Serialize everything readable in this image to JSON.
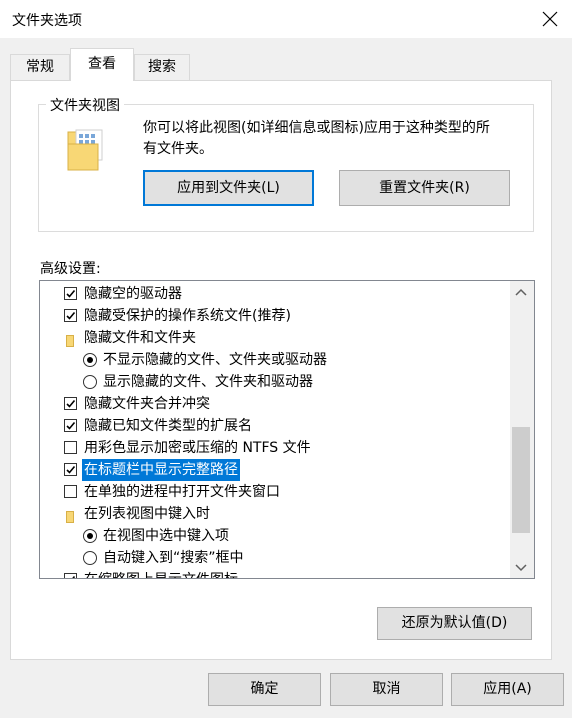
{
  "window": {
    "title": "文件夹选项"
  },
  "tabs": [
    {
      "label": "常规"
    },
    {
      "label": "查看"
    },
    {
      "label": "搜索"
    }
  ],
  "folder_views": {
    "group_label": "文件夹视图",
    "description_line1": "你可以将此视图(如详细信息或图标)应用于这种类型的所",
    "description_line2": "有文件夹。",
    "apply_button": "应用到文件夹(L)",
    "reset_button": "重置文件夹(R)"
  },
  "advanced": {
    "label": "高级设置:",
    "items": [
      {
        "type": "checkbox",
        "checked": true,
        "label": "隐藏空的驱动器"
      },
      {
        "type": "checkbox",
        "checked": true,
        "label": "隐藏受保护的操作系统文件(推荐)"
      },
      {
        "type": "folder",
        "label": "隐藏文件和文件夹"
      },
      {
        "type": "radio",
        "checked": true,
        "label": "不显示隐藏的文件、文件夹或驱动器"
      },
      {
        "type": "radio",
        "checked": false,
        "label": "显示隐藏的文件、文件夹和驱动器"
      },
      {
        "type": "checkbox",
        "checked": true,
        "label": "隐藏文件夹合并冲突"
      },
      {
        "type": "checkbox",
        "checked": true,
        "label": "隐藏已知文件类型的扩展名"
      },
      {
        "type": "checkbox",
        "checked": false,
        "label": "用彩色显示加密或压缩的 NTFS 文件"
      },
      {
        "type": "checkbox",
        "checked": true,
        "label": "在标题栏中显示完整路径",
        "selected": true
      },
      {
        "type": "checkbox",
        "checked": false,
        "label": "在单独的进程中打开文件夹窗口"
      },
      {
        "type": "folder",
        "label": "在列表视图中键入时"
      },
      {
        "type": "radio",
        "checked": true,
        "label": "在视图中选中键入项"
      },
      {
        "type": "radio",
        "checked": false,
        "label": "自动键入到“搜索”框中"
      },
      {
        "type": "checkbox",
        "checked": true,
        "label": "在缩略图上显示文件图标"
      }
    ]
  },
  "restore_defaults_button": "还原为默认值(D)",
  "footer": {
    "ok": "确定",
    "cancel": "取消",
    "apply": "应用(A)"
  }
}
